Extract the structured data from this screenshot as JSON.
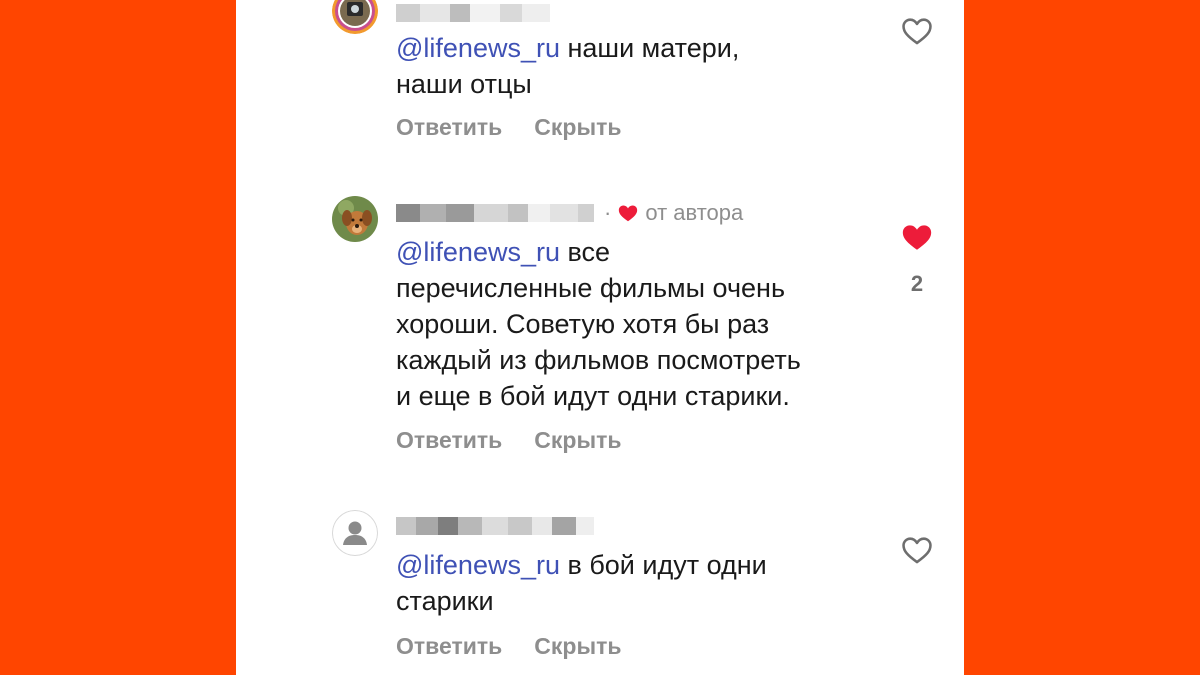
{
  "comments": [
    {
      "avatar": "photo-avatar-icon",
      "mention": "@lifenews_ru",
      "text_line1": " наши матери,",
      "text_line2": "наши отцы",
      "reply": "Ответить",
      "hide": "Скрыть",
      "liked": false
    },
    {
      "avatar": "dog-photo-avatar",
      "author_badge": "от автора",
      "mention": "@lifenews_ru",
      "text_line1": " все",
      "text_rest": [
        "перечисленные фильмы очень",
        "хороши. Советую хотя бы раз",
        "каждый из фильмов посмотреть",
        "и еще в бой идут одни старики."
      ],
      "reply": "Ответить",
      "hide": "Скрыть",
      "liked": true,
      "like_count": "2"
    },
    {
      "avatar": "default-user-avatar",
      "mention": "@lifenews_ru",
      "text_line1": " в бой идут одни",
      "text_line2": "старики",
      "reply": "Ответить",
      "hide": "Скрыть",
      "liked": false
    }
  ],
  "colors": {
    "background": "#FF4500",
    "mention": "#3f51b5",
    "muted": "#8e8e8e",
    "heart_liked": "#ed1c3a"
  }
}
